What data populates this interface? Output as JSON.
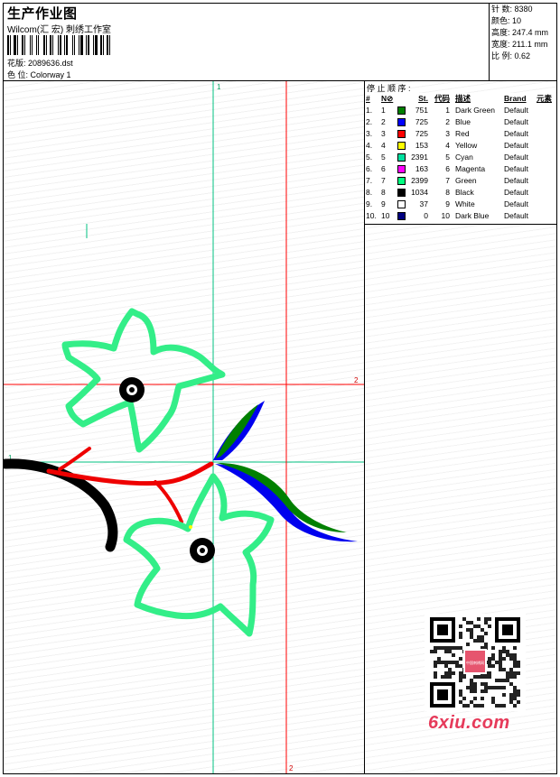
{
  "header": {
    "title": "生产作业图",
    "subtitle": "Wilcom(汇 宏) 刺绣工作室",
    "design_label": "花版:",
    "design_value": "2089636.dst",
    "colorway_label": "色 位:",
    "colorway_value": "Colorway 1"
  },
  "stats": {
    "stitches_label": "针 数:",
    "stitches": "8380",
    "colors_label": "颜色:",
    "colors": "10",
    "height_label": "高度:",
    "height": "247.4 mm",
    "width_label": "宽度:",
    "width": "211.1 mm",
    "scale_label": "比 例:",
    "scale": "0.62"
  },
  "canvas": {
    "marker_top": "1",
    "marker_right": "2",
    "marker_left": "1",
    "marker_bottom": "2"
  },
  "stop_sequence": {
    "title": "停 止 顺 序 :",
    "headers": {
      "idx": "#",
      "n": "N⊘",
      "st": "St.",
      "code": "代码",
      "desc": "描述",
      "brand": "Brand",
      "elem": "元素"
    },
    "rows": [
      {
        "idx": "1.",
        "n": "1",
        "color": "#008000",
        "st": "751",
        "code": "1",
        "desc": "Dark Green",
        "brand": "Default"
      },
      {
        "idx": "2.",
        "n": "2",
        "color": "#0000ff",
        "st": "725",
        "code": "2",
        "desc": "Blue",
        "brand": "Default"
      },
      {
        "idx": "3.",
        "n": "3",
        "color": "#ff0000",
        "st": "725",
        "code": "3",
        "desc": "Red",
        "brand": "Default"
      },
      {
        "idx": "4.",
        "n": "4",
        "color": "#ffff00",
        "st": "153",
        "code": "4",
        "desc": "Yellow",
        "brand": "Default"
      },
      {
        "idx": "5.",
        "n": "5",
        "color": "#00e0a0",
        "st": "2391",
        "code": "5",
        "desc": "Cyan",
        "brand": "Default"
      },
      {
        "idx": "6.",
        "n": "6",
        "color": "#ff00ff",
        "st": "163",
        "code": "6",
        "desc": "Magenta",
        "brand": "Default"
      },
      {
        "idx": "7.",
        "n": "7",
        "color": "#00ff80",
        "st": "2399",
        "code": "7",
        "desc": "Green",
        "brand": "Default"
      },
      {
        "idx": "8.",
        "n": "8",
        "color": "#000000",
        "st": "1034",
        "code": "8",
        "desc": "Black",
        "brand": "Default"
      },
      {
        "idx": "9.",
        "n": "9",
        "color": "#ffffff",
        "st": "37",
        "code": "9",
        "desc": "White",
        "brand": "Default"
      },
      {
        "idx": "10.",
        "n": "10",
        "color": "#000080",
        "st": "0",
        "code": "10",
        "desc": "Dark Blue",
        "brand": "Default"
      }
    ]
  },
  "watermark": {
    "logo_text": "6xiu.com",
    "qr_center_text": "中国刺绣网"
  },
  "colors": {
    "green_guide": "#00c080",
    "red_guide": "#ff0000",
    "petal": "#33ee88"
  }
}
